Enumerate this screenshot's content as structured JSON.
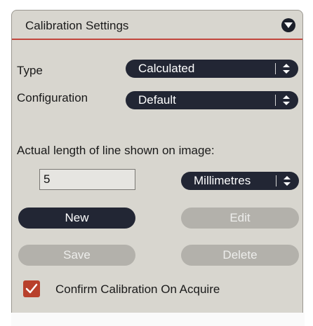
{
  "panel": {
    "title": "Calibration Settings",
    "collapse_icon": "chevron-down-circle-icon",
    "accent_color": "#c2463d"
  },
  "type_field": {
    "label": "Type",
    "value": "Calculated",
    "icon": "select-arrows-icon"
  },
  "configuration_field": {
    "label": "Configuration",
    "value": "Default",
    "icon": "select-arrows-icon"
  },
  "length": {
    "label": "Actual length of line shown on image:",
    "value": "5",
    "unit": "Millimetres"
  },
  "buttons": {
    "new": "New",
    "edit": "Edit",
    "save": "Save",
    "delete": "Delete"
  },
  "confirm": {
    "label": "Confirm Calibration On Acquire",
    "checked": true,
    "color": "#b8402c"
  }
}
